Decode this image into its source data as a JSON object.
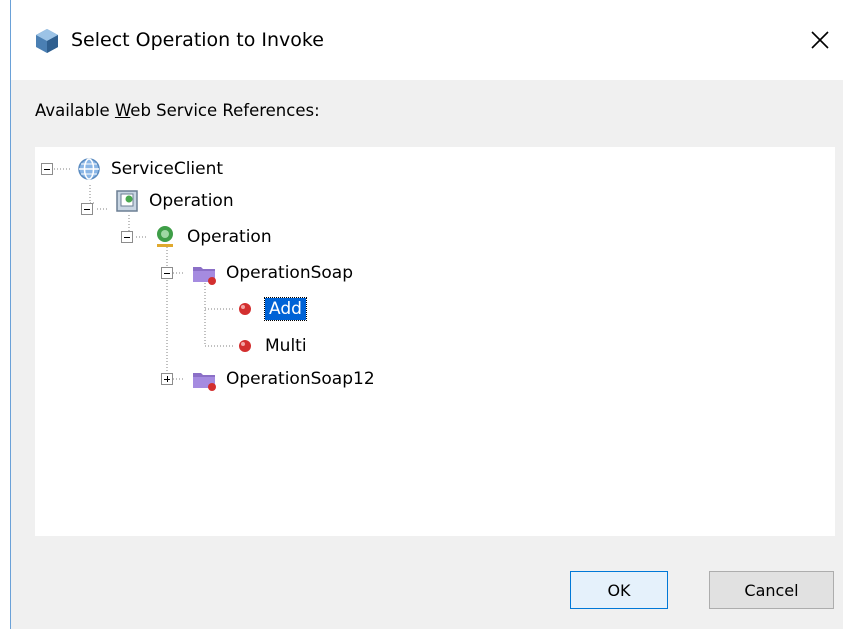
{
  "dialog": {
    "title": "Select Operation to Invoke",
    "close_glyph": "✕",
    "refs_label_pre": "Available ",
    "refs_label_mnemonic": "W",
    "refs_label_post": "eb Service References:",
    "ok_label": "OK",
    "cancel_label": "Cancel"
  },
  "tree": {
    "root": "ServiceClient",
    "service": "Operation",
    "port_group": "Operation",
    "soap": "OperationSoap",
    "method_add": "Add",
    "method_multi": "Multi",
    "soap12": "OperationSoap12"
  },
  "icons": {
    "title": "webservice-cube-icon",
    "root": "globe-icon",
    "service": "service-icon",
    "port": "port-icon",
    "folder": "folder-icon",
    "method": "red-ball-icon"
  },
  "colors": {
    "selection": "#0063d6",
    "ok_border": "#0078d7",
    "method_red": "#d32f2f"
  }
}
